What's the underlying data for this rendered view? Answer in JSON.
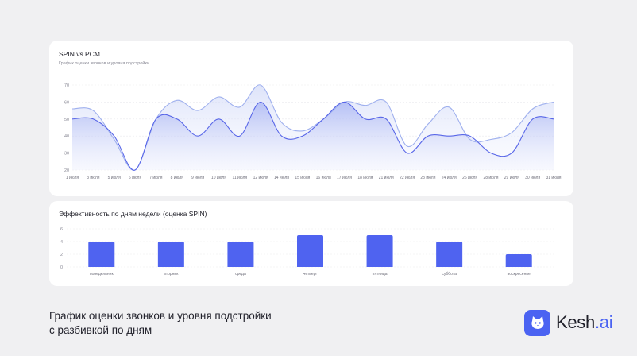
{
  "line_chart": {
    "title": "SPIN vs PCM",
    "subtitle": "График оценки звонков и уровня подстройки"
  },
  "bar_chart": {
    "title": "Эффективность по дням недели (оценка SPIN)"
  },
  "footer": {
    "caption_line1": "График оценки звонков и уровня подстройки",
    "caption_line2": "с разбивкой по дням"
  },
  "brand": {
    "name_main": "Kesh",
    "name_suffix": ".ai",
    "icon": "cat-face-icon",
    "color": "#4b63f2"
  },
  "chart_data": [
    {
      "type": "area",
      "title": "SPIN vs PCM",
      "subtitle": "График оценки звонков и уровня подстройки",
      "categories": [
        "1 июля",
        "3 июля",
        "5 июля",
        "6 июля",
        "7 июля",
        "8 июля",
        "9 июля",
        "10 июля",
        "11 июля",
        "12 июля",
        "14 июля",
        "15 июля",
        "16 июля",
        "17 июля",
        "18 июля",
        "21 июля",
        "22 июля",
        "23 июля",
        "24 июля",
        "26 июля",
        "28 июля",
        "29 июля",
        "30 июля",
        "31 июля"
      ],
      "series": [
        {
          "color": "#5866e8",
          "values": [
            50,
            50,
            40,
            20,
            50,
            50,
            40,
            50,
            40,
            60,
            40,
            40,
            50,
            60,
            50,
            50,
            30,
            40,
            40,
            40,
            30,
            30,
            50,
            50
          ]
        },
        {
          "color": "#9fb0ee",
          "values": [
            56,
            55,
            38,
            20,
            50,
            61,
            55,
            63,
            57,
            70,
            48,
            43,
            50,
            60,
            58,
            60,
            34,
            47,
            57,
            38,
            38,
            42,
            56,
            60
          ]
        }
      ],
      "yticks": [
        20,
        30,
        40,
        50,
        60,
        70
      ],
      "ylim": [
        20,
        70
      ],
      "grid": true
    },
    {
      "type": "bar",
      "title": "Эффективность по дням недели (оценка SPIN)",
      "categories": [
        "понедельник",
        "вторник",
        "среда",
        "четверг",
        "пятница",
        "суббота",
        "воскресенье"
      ],
      "values": [
        4,
        4,
        4,
        5,
        5,
        4,
        2
      ],
      "yticks": [
        0,
        2,
        4,
        6
      ],
      "ylim": [
        0,
        6
      ],
      "grid": true,
      "color": "#4f63f0"
    }
  ]
}
